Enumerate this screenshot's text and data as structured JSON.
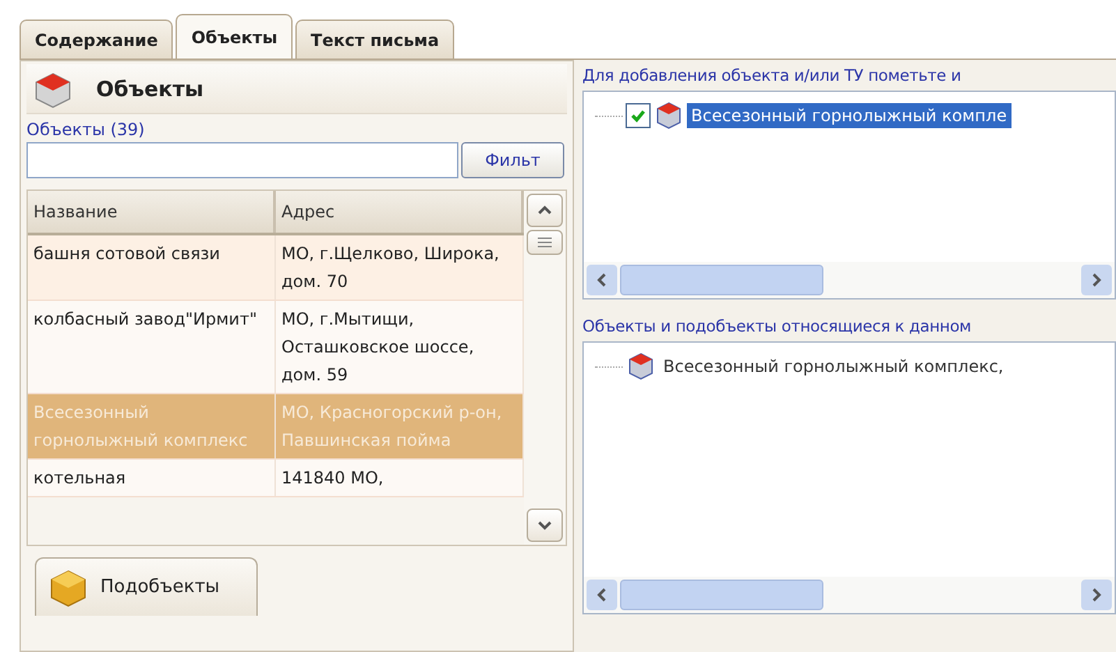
{
  "tabs": [
    {
      "label": "Содержание",
      "selected": false
    },
    {
      "label": "Объекты",
      "selected": true
    },
    {
      "label": "Текст письма",
      "selected": false
    }
  ],
  "objects_panel": {
    "title": "Объекты",
    "count_label": "Объекты (39)",
    "filter": {
      "button": "Фильт"
    },
    "table": {
      "columns": [
        "Название",
        "Адрес"
      ],
      "rows": [
        {
          "name": "башня сотовой связи",
          "address": "МО, г.Щелково, Широка, дом. 70",
          "selected": false
        },
        {
          "name": "колбасный завод\"Ирмит\"",
          "address": "МО, г.Мытищи, Осташковское шоссе, дом. 59",
          "selected": false
        },
        {
          "name": "Всесезонный горнолыжный комплекс",
          "address": "МО, Красногорский р-он, Павшинская пойма",
          "selected": true
        },
        {
          "name": "котельная",
          "address": "141840 МО,",
          "selected": false
        }
      ]
    },
    "bottom_tab": "Подобъекты"
  },
  "add_panel": {
    "label": "Для добавления объекта и/или ТУ пометьте и",
    "items": [
      {
        "label": "Всесезонный горнолыжный компле",
        "checked": true,
        "selected": true
      }
    ]
  },
  "related_panel": {
    "label": "Объекты и подобъекты относящиеся к данном",
    "items": [
      {
        "label": "Всесезонный горнолыжный комплекс,",
        "selected": false
      }
    ]
  }
}
